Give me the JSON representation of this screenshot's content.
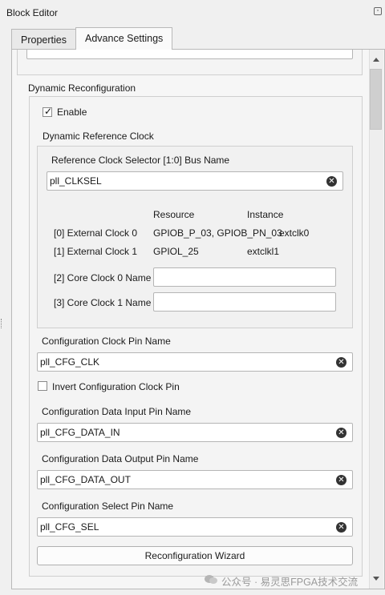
{
  "window": {
    "title": "Block Editor"
  },
  "tabs": [
    {
      "label": "Properties",
      "active": false
    },
    {
      "label": "Advance Settings",
      "active": true
    }
  ],
  "dynamic_reconfig": {
    "title": "Dynamic Reconfiguration",
    "enable": {
      "label": "Enable",
      "checked": true
    },
    "ref_clock": {
      "title": "Dynamic Reference Clock",
      "bus_label": "Reference Clock Selector [1:0] Bus Name",
      "bus_value": "pll_CLKSEL",
      "headers": {
        "resource": "Resource",
        "instance": "Instance"
      },
      "rows": [
        {
          "name": "[0] External Clock 0",
          "resource": "GPIOB_P_03, GPIOB_PN_03",
          "instance": "extclk0"
        },
        {
          "name": "[1] External Clock 1",
          "resource": "GPIOL_25",
          "instance": "extclkl1"
        }
      ],
      "core0_label": "[2] Core Clock 0 Name",
      "core0_value": "",
      "core1_label": "[3] Core Clock 1 Name",
      "core1_value": ""
    },
    "cfg_clk": {
      "label": "Configuration Clock Pin Name",
      "value": "pll_CFG_CLK"
    },
    "invert": {
      "label": "Invert Configuration Clock Pin",
      "checked": false
    },
    "cfg_data_in": {
      "label": "Configuration Data Input Pin Name",
      "value": "pll_CFG_DATA_IN"
    },
    "cfg_data_out": {
      "label": "Configuration Data Output Pin Name",
      "value": "pll_CFG_DATA_OUT"
    },
    "cfg_sel": {
      "label": "Configuration Select Pin Name",
      "value": "pll_CFG_SEL"
    },
    "wizard_button": "Reconfiguration Wizard"
  },
  "watermark": "公众号 · 易灵思FPGA技术交流",
  "icons": {
    "clear": "clear-icon",
    "check": "check-icon",
    "float": "float-window-icon",
    "scroll_up": "chevron-up-icon",
    "scroll_down": "chevron-down-icon",
    "watermark": "wechat-icon"
  }
}
